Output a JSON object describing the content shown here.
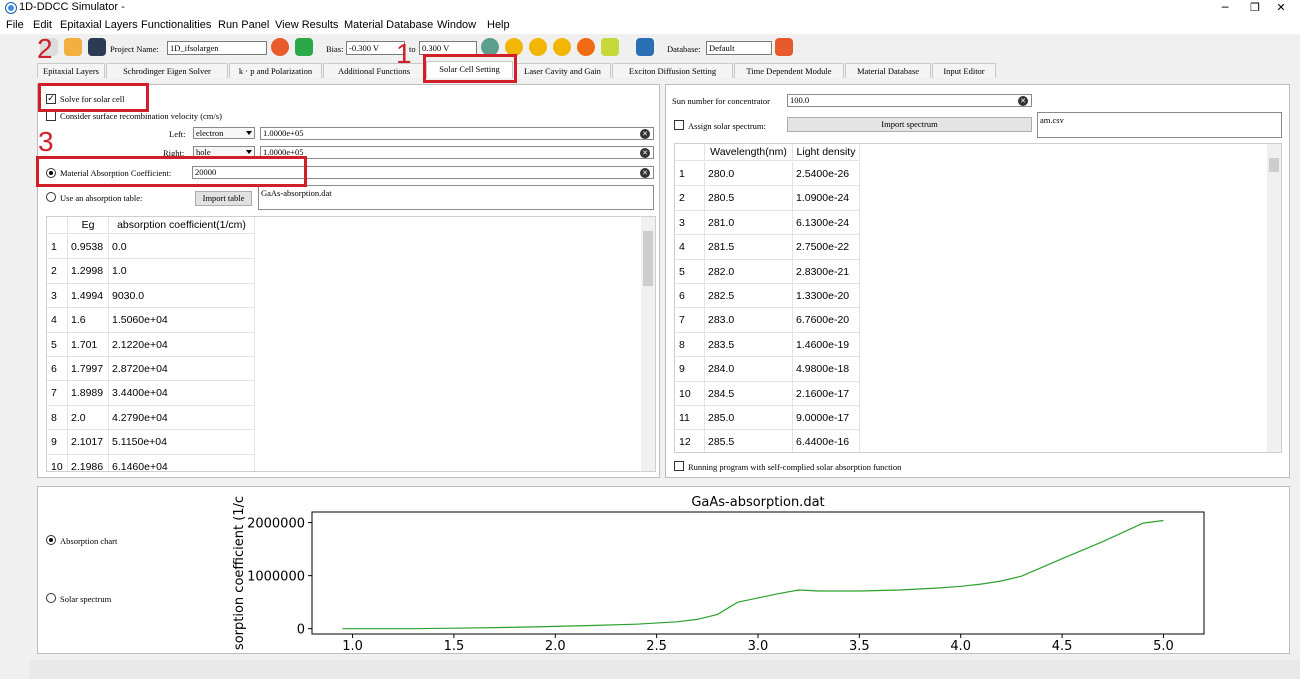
{
  "window": {
    "title": "1D-DDCC Simulator -",
    "minimize": "─",
    "maximize": "❐",
    "close": "✕"
  },
  "menu": [
    "File",
    "Edit",
    "Epitaxial Layers",
    "Functionalities",
    "Run Panel",
    "View Results",
    "Material Database",
    "Window",
    "Help"
  ],
  "toolbar": {
    "project_label": "Project Name:",
    "project_value": "1D_ifsolargen",
    "bias_label": "Bias:",
    "bias_from": "-0.300 V",
    "to_label": "to",
    "bias_to": "0.300 V",
    "database_label": "Database:",
    "database_value": "Default",
    "icon_colors": {
      "folder": "#f4b03e",
      "save": "#2b3a55",
      "refresh": "#e85a2c",
      "run": "#f2b705",
      "green": "#2aa84a"
    }
  },
  "tabs": [
    "Epitaxial Layers",
    "Schrodinger Eigen Solver",
    "k · p and Polarization",
    "Additional Functions",
    "Solar Cell Setting",
    "Laser Cavity and Gain",
    "Exciton Diffusion Setting",
    "Time Dependent Module",
    "Material Database",
    "Input Editor"
  ],
  "active_tab": "Solar Cell Setting",
  "left": {
    "solve_label": "Solve for solar cell",
    "surface_label": "Consider surface recombination velocity (cm/s)",
    "left_label": "Left:",
    "left_carrier": "electron",
    "left_value": "1.0000e+05",
    "right_label": "Right:",
    "right_carrier": "hole",
    "right_value": "1.0000e+05",
    "mac_label": "Material Absorption Coefficient:",
    "mac_value": "20000",
    "table_label": "Use an absorption table:",
    "import_table": "Import table",
    "table_file": "GaAs-absorption.dat",
    "columns": [
      "Eg",
      "absorption coefficient(1/cm)"
    ],
    "rows": [
      [
        "1",
        "0.9538",
        "0.0"
      ],
      [
        "2",
        "1.2998",
        "1.0"
      ],
      [
        "3",
        "1.4994",
        "9030.0"
      ],
      [
        "4",
        "1.6",
        "1.5060e+04"
      ],
      [
        "5",
        "1.701",
        "2.1220e+04"
      ],
      [
        "6",
        "1.7997",
        "2.8720e+04"
      ],
      [
        "7",
        "1.8989",
        "3.4400e+04"
      ],
      [
        "8",
        "2.0",
        "4.2790e+04"
      ],
      [
        "9",
        "2.1017",
        "5.1150e+04"
      ],
      [
        "10",
        "2.1986",
        "6.1460e+04"
      ]
    ]
  },
  "right": {
    "sun_label": "Sun number for concentrator",
    "sun_value": "100.0",
    "assign_label": "Assign solar spectrum:",
    "import_spectrum": "Import spectrum",
    "spectrum_file": "am.csv",
    "columns": [
      "Wavelength(nm)",
      "Light density"
    ],
    "rows": [
      [
        "1",
        "280.0",
        "2.5400e-26"
      ],
      [
        "2",
        "280.5",
        "1.0900e-24"
      ],
      [
        "3",
        "281.0",
        "6.1300e-24"
      ],
      [
        "4",
        "281.5",
        "2.7500e-22"
      ],
      [
        "5",
        "282.0",
        "2.8300e-21"
      ],
      [
        "6",
        "282.5",
        "1.3300e-20"
      ],
      [
        "7",
        "283.0",
        "6.7600e-20"
      ],
      [
        "8",
        "283.5",
        "1.4600e-19"
      ],
      [
        "9",
        "284.0",
        "4.9800e-18"
      ],
      [
        "10",
        "284.5",
        "2.1600e-17"
      ],
      [
        "11",
        "285.0",
        "9.0000e-17"
      ],
      [
        "12",
        "285.5",
        "6.4400e-16"
      ]
    ],
    "running_label": "Running program with self-complied solar absorption function"
  },
  "chart_panel": {
    "absorption_chart": "Absorption chart",
    "solar_spectrum": "Solar spectrum"
  },
  "annotations": {
    "n1": "1",
    "n2": "2",
    "n3": "3",
    "color": "#d11f2a"
  },
  "chart_data": {
    "type": "line",
    "title": "GaAs-absorption.dat",
    "xlabel": "",
    "ylabel": "sorption coefficient (1/c",
    "xlim": [
      0.8,
      5.2
    ],
    "ylim": [
      -100000,
      2200000
    ],
    "xticks": [
      "1.0",
      "1.5",
      "2.0",
      "2.5",
      "3.0",
      "3.5",
      "4.0",
      "4.5",
      "5.0"
    ],
    "yticks": [
      "0",
      "1000000",
      "2000000"
    ],
    "line_color": "#2ca02c",
    "series": [
      {
        "x": [
          0.95,
          1.3,
          1.5,
          1.7,
          1.9,
          2.0,
          2.2,
          2.4,
          2.6,
          2.7,
          2.8,
          2.9,
          3.0,
          3.1,
          3.2,
          3.3,
          3.5,
          3.7,
          3.9,
          4.0,
          4.1,
          4.2,
          4.3,
          4.5,
          4.7,
          4.9,
          5.0
        ],
        "y": [
          0,
          1,
          9030,
          21220,
          34400,
          42790,
          61460,
          85000,
          130000,
          175000,
          270000,
          500000,
          580000,
          660000,
          730000,
          710000,
          710000,
          730000,
          770000,
          800000,
          840000,
          900000,
          990000,
          1320000,
          1640000,
          1990000,
          2040000
        ]
      }
    ]
  }
}
